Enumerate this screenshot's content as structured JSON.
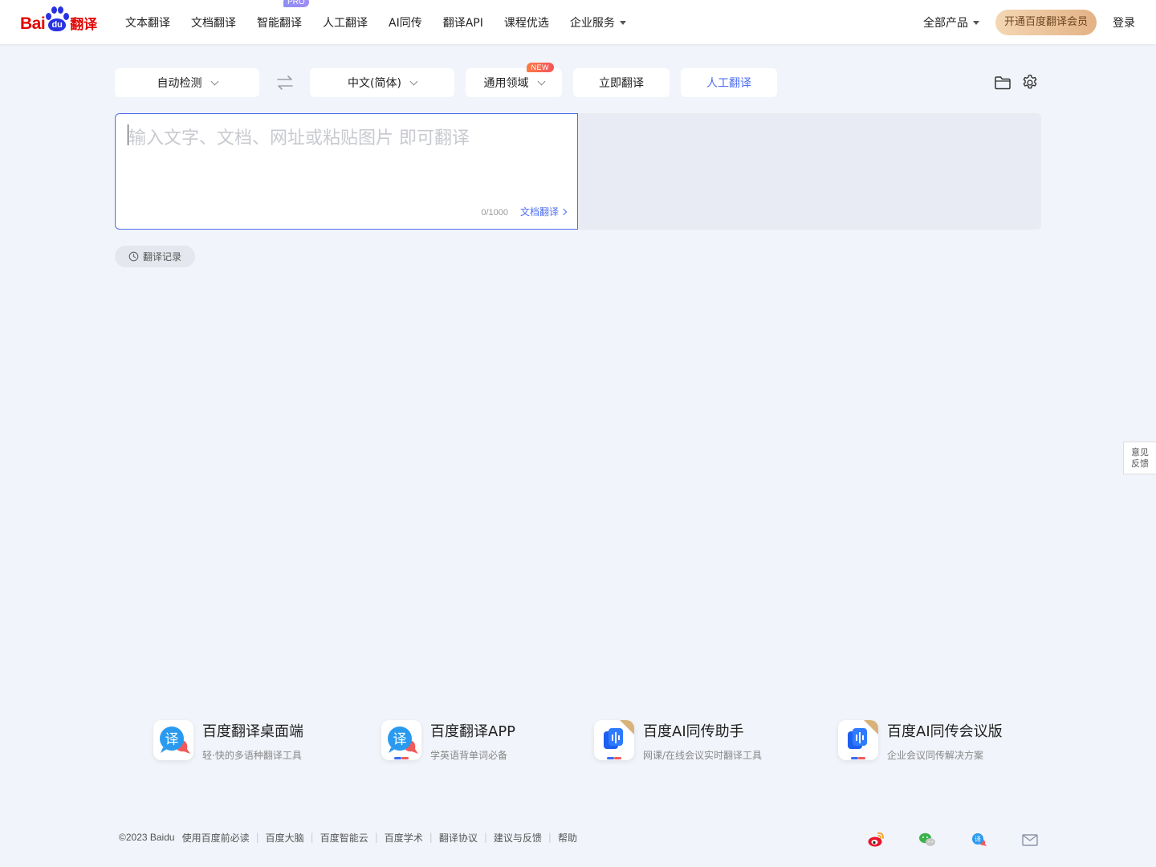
{
  "header": {
    "logo": {
      "bai": "Bai",
      "du": "du",
      "fanyi": "翻译"
    },
    "nav": [
      {
        "label": "文本翻译"
      },
      {
        "label": "文档翻译"
      },
      {
        "label": "智能翻译",
        "badge": "PRO"
      },
      {
        "label": "人工翻译"
      },
      {
        "label": "AI同传"
      },
      {
        "label": "翻译API"
      },
      {
        "label": "课程优选"
      },
      {
        "label": "企业服务"
      }
    ],
    "all_products": "全部产品",
    "vip_button": "开通百度翻译会员",
    "login": "登录"
  },
  "toolbar": {
    "source_lang": "自动检测",
    "target_lang": "中文(简体)",
    "domain": "通用领域",
    "domain_badge": "NEW",
    "translate_button": "立即翻译",
    "human_button": "人工翻译"
  },
  "editor": {
    "placeholder": "输入文字、文档、网址或粘贴图片 即可翻译",
    "counter": "0/1000",
    "doc_link": "文档翻译"
  },
  "history_button": "翻译记录",
  "feedback": {
    "line1": "意见",
    "line2": "反馈"
  },
  "products": [
    {
      "name": "百度翻译桌面端",
      "desc": "轻·快的多语种翻译工具"
    },
    {
      "name": "百度翻译APP",
      "desc": "学英语背单词必备"
    },
    {
      "name": "百度AI同传助手",
      "desc": "网课/在线会议实时翻译工具"
    },
    {
      "name": "百度AI同传会议版",
      "desc": "企业会议同传解决方案"
    }
  ],
  "footer": {
    "copyright": "©2023 Baidu",
    "links": [
      "使用百度前必读",
      "百度大脑",
      "百度智能云",
      "百度学术",
      "翻译协议",
      "建议与反馈",
      "帮助"
    ]
  },
  "colors": {
    "brand_red": "#e10602",
    "brand_blue": "#2932e1",
    "accent": "#4e6ef2",
    "page_bg": "#f1f4fa"
  }
}
